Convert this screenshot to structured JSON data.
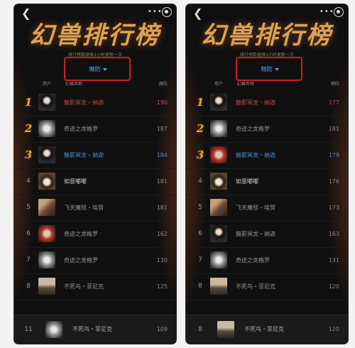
{
  "screens": [
    {
      "title": "幻兽排行榜",
      "subtitle": "排行榜数据每1小时更新一次",
      "sort_label": "魔防",
      "headers": {
        "user": "用户",
        "name": "幻兽名称",
        "value": "魔防"
      },
      "rows": [
        {
          "rank": "1",
          "name": "魅影冥龙・纳迦",
          "value": "190",
          "style": "red",
          "avatar": "girl"
        },
        {
          "rank": "2",
          "name": "奇迹之龙格罗",
          "value": "187",
          "style": "normal",
          "avatar": "dragon"
        },
        {
          "rank": "3",
          "name": "魅影冥龙・纳迦",
          "value": "184",
          "style": "blue",
          "avatar": "girl"
        },
        {
          "rank": "4",
          "name": "如意嘟嘟",
          "value": "181",
          "style": "white",
          "avatar": "cartoon"
        },
        {
          "rank": "5",
          "name": "飞天魔毯・埃努",
          "value": "181",
          "style": "normal",
          "avatar": "beast"
        },
        {
          "rank": "6",
          "name": "奇迹之龙格罗",
          "value": "162",
          "style": "normal",
          "avatar": "fire"
        },
        {
          "rank": "7",
          "name": "奇迹之龙格罗",
          "value": "130",
          "style": "normal",
          "avatar": "dragon"
        },
        {
          "rank": "8",
          "name": "不死鸟・菲尼克",
          "value": "125",
          "style": "normal",
          "avatar": "bird"
        }
      ],
      "self_row": {
        "rank": "11",
        "name": "不死鸟・菲尼克",
        "value": "109"
      }
    },
    {
      "title": "幻兽排行榜",
      "subtitle": "排行榜数据每1小时更新一次",
      "sort_label": "物防",
      "headers": {
        "user": "用户",
        "name": "幻兽名称",
        "value": "物防"
      },
      "rows": [
        {
          "rank": "1",
          "name": "魅影冥龙・纳迦",
          "value": "177",
          "style": "red",
          "avatar": "girl"
        },
        {
          "rank": "2",
          "name": "奇迹之龙格罗",
          "value": "181",
          "style": "normal",
          "avatar": "dragon"
        },
        {
          "rank": "3",
          "name": "魅影冥龙・纳迦",
          "value": "179",
          "style": "blue",
          "avatar": "fire"
        },
        {
          "rank": "4",
          "name": "如意嘟嘟",
          "value": "176",
          "style": "white",
          "avatar": "cartoon"
        },
        {
          "rank": "5",
          "name": "飞天魔毯・埃努",
          "value": "173",
          "style": "normal",
          "avatar": "beast"
        },
        {
          "rank": "6",
          "name": "魅影冥龙・纳迦",
          "value": "163",
          "style": "normal",
          "avatar": "girl"
        },
        {
          "rank": "7",
          "name": "奇迹之龙格罗",
          "value": "131",
          "style": "normal",
          "avatar": "dragon"
        },
        {
          "rank": "8",
          "name": "不死鸟・菲尼克",
          "value": "120",
          "style": "normal",
          "avatar": "bird"
        }
      ],
      "self_row": {
        "rank": "8",
        "name": "不死鸟・菲尼克",
        "value": "120"
      }
    }
  ],
  "icons": {
    "back": "back-arrow-icon",
    "more": "more-dots-icon",
    "close": "close-circle-icon"
  },
  "colors": {
    "background": "#101011",
    "accent_red": "#d01c1c",
    "select_blue": "#5aa0e6",
    "medal_gold": "#e6a937"
  }
}
